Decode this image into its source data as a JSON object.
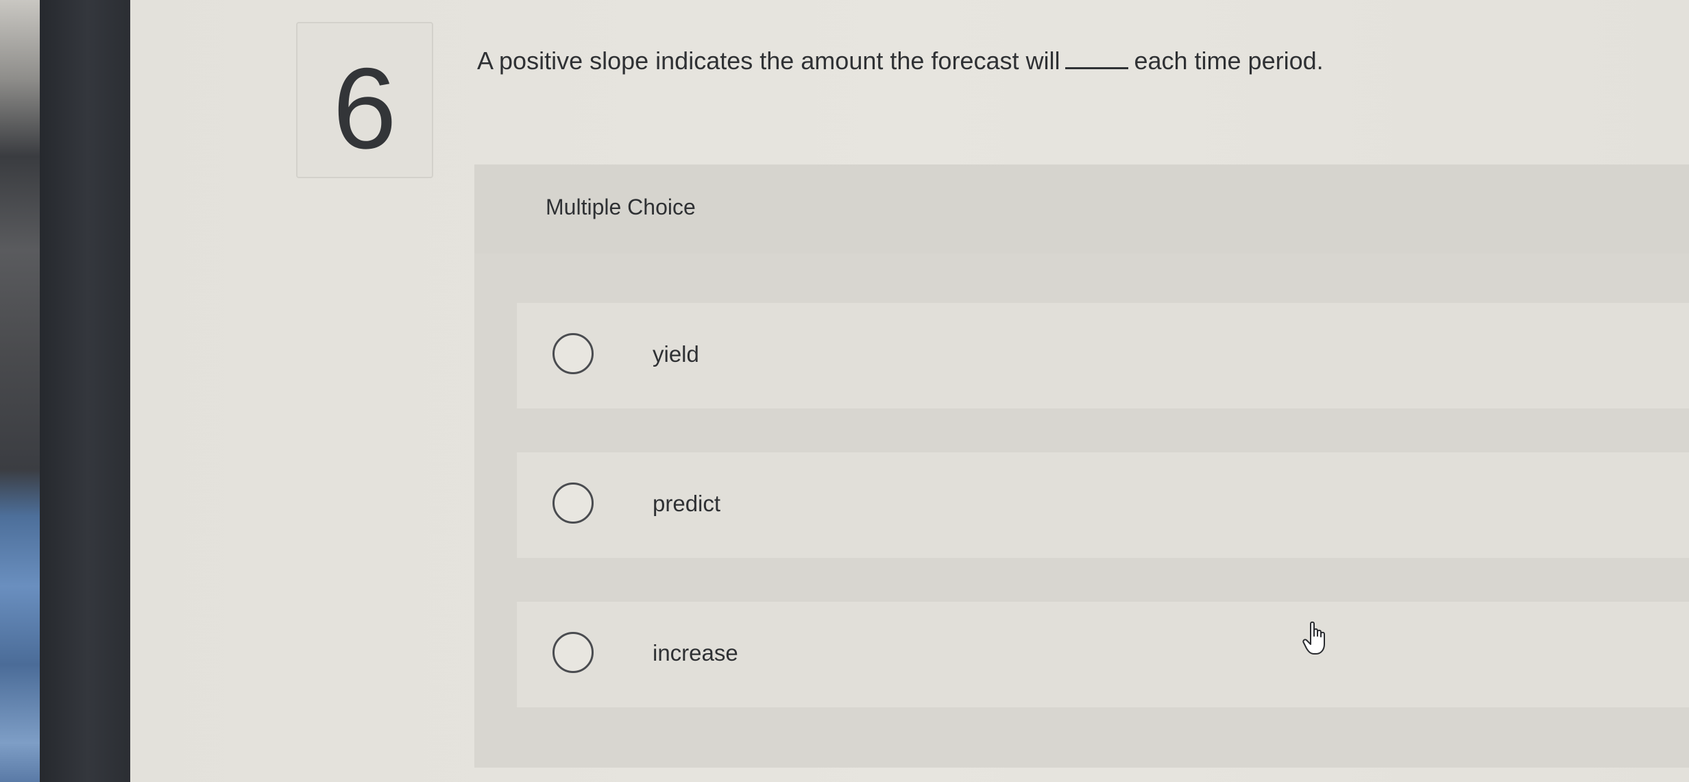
{
  "question": {
    "number": "6",
    "text_before": "A positive slope indicates the amount the forecast will",
    "text_after": "each time period."
  },
  "multiple_choice": {
    "label": "Multiple Choice",
    "options": [
      {
        "label": "yield",
        "selected": false
      },
      {
        "label": "predict",
        "selected": false
      },
      {
        "label": "increase",
        "selected": false
      }
    ]
  },
  "icons": {
    "cursor": "hand-pointer-icon"
  }
}
